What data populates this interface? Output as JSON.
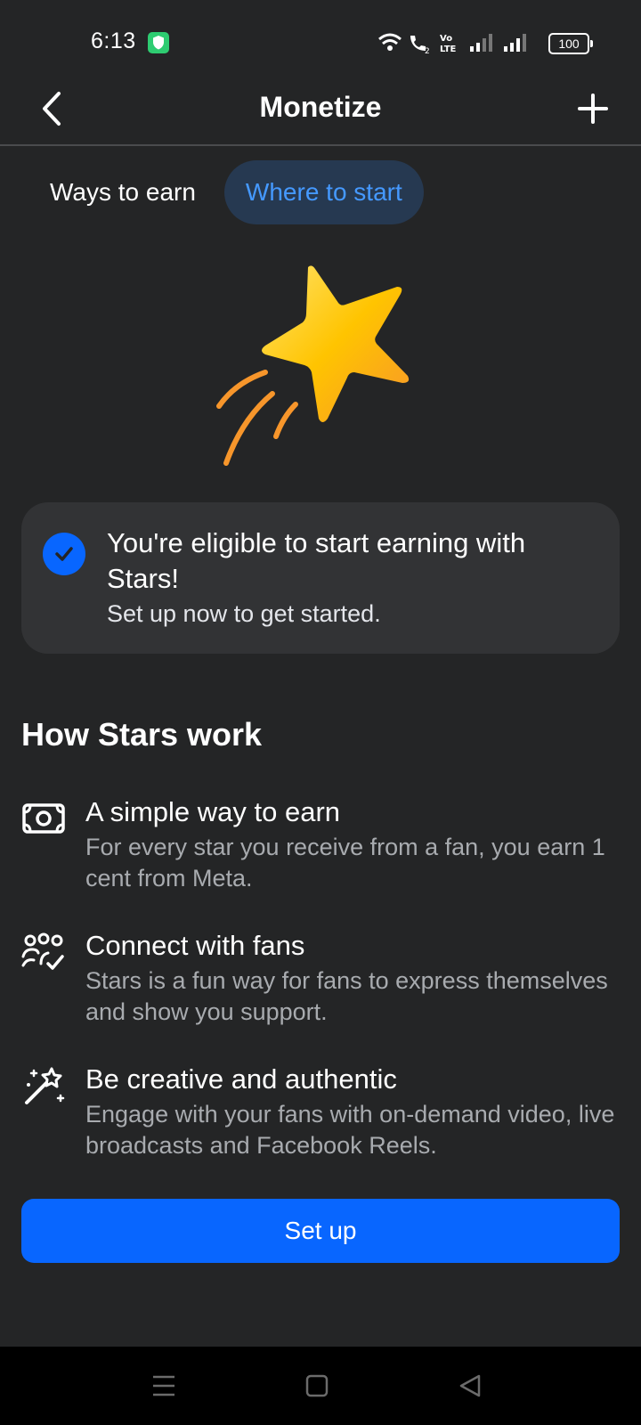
{
  "status_bar": {
    "time": "6:13",
    "battery": "100",
    "icons": [
      "shield-icon",
      "wifi-icon",
      "wifi-call-icon",
      "volte-icon",
      "signal-icon",
      "signal-icon",
      "battery-icon"
    ]
  },
  "header": {
    "title": "Monetize",
    "back_icon": "chevron-left-icon",
    "add_icon": "plus-icon"
  },
  "tabs": [
    {
      "label": "Ways to earn",
      "active": false
    },
    {
      "label": "Where to start",
      "active": true
    }
  ],
  "card": {
    "title": "You're eligible to start earning with Stars!",
    "subtitle": "Set up now to get started.",
    "icon": "check-circle-icon"
  },
  "section": {
    "title": "How Stars work",
    "features": [
      {
        "icon": "cash-icon",
        "title": "A simple way to earn",
        "description": "For every star you receive from a fan, you earn 1 cent from Meta."
      },
      {
        "icon": "people-check-icon",
        "title": "Connect with fans",
        "description": "Stars is a fun way for fans to express themselves and show you support."
      },
      {
        "icon": "magic-wand-icon",
        "title": "Be creative and authentic",
        "description": "Engage with your fans with on-demand video, live broadcasts and Facebook Reels."
      }
    ]
  },
  "button": {
    "label": "Set up"
  },
  "colors": {
    "background": "#242526",
    "accent": "#0866ff",
    "tab_active_bg": "#263951",
    "tab_active_text": "#4599ff",
    "card_bg": "#323335"
  }
}
